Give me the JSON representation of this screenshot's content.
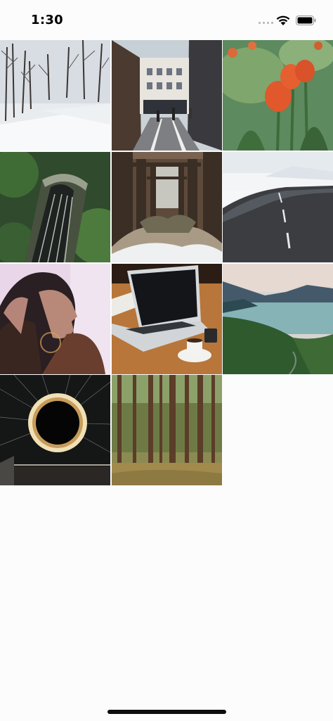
{
  "status_bar": {
    "time": "1:30",
    "signal_icon": "cellular-signal-icon",
    "wifi_icon": "wifi-icon",
    "battery_icon": "battery-icon"
  },
  "photos": [
    {
      "name": "photo-snowy-forest-road"
    },
    {
      "name": "photo-city-street"
    },
    {
      "name": "photo-orange-tulips"
    },
    {
      "name": "photo-tunnel-railway"
    },
    {
      "name": "photo-pier-waves"
    },
    {
      "name": "photo-snowy-road"
    },
    {
      "name": "photo-woman-portrait"
    },
    {
      "name": "photo-laptop-coffee"
    },
    {
      "name": "photo-mountain-lake"
    },
    {
      "name": "photo-steel-wool-circle"
    },
    {
      "name": "photo-pine-forest"
    }
  ]
}
